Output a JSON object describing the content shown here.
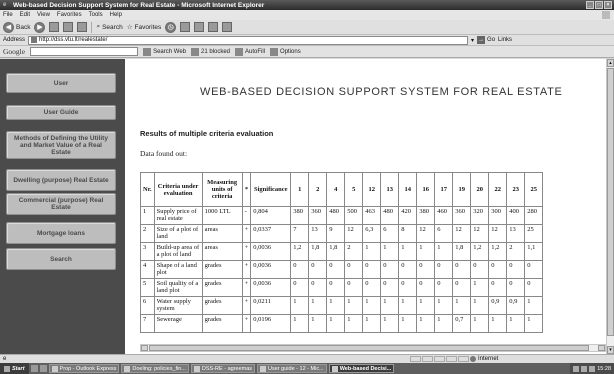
{
  "window": {
    "title": "Web-based Decision Support System for Real Estate - Microsoft Internet Explorer",
    "menu": [
      "File",
      "Edit",
      "View",
      "Favorites",
      "Tools",
      "Help"
    ]
  },
  "toolbar": {
    "back": "Back",
    "search": "Search",
    "favorites": "Favorites"
  },
  "address": {
    "label": "Address",
    "url": "http://dss.vtu.lt/realestate/",
    "go": "Go",
    "links": "Links"
  },
  "googlebar": {
    "logo": "Google",
    "search_web": "Search Web",
    "blocked": "21 blocked",
    "autofill": "AutoFill",
    "options": "Options"
  },
  "sidebar": {
    "items": [
      {
        "label": "User"
      },
      {
        "label": "User Guide"
      },
      {
        "label": "Methods of Defining the Utility and Market Value of a Real Estate"
      },
      {
        "label": "Dwelling (purpose) Real Estate"
      },
      {
        "label": "Commercial (purpose) Real Estate"
      },
      {
        "label": "Mortgage loans"
      },
      {
        "label": "Search"
      }
    ]
  },
  "main": {
    "title": "WEB-BASED DECISION SUPPORT SYSTEM FOR REAL ESTATE",
    "section_title": "Results of multiple criteria evaluation",
    "found_text": "Data found out:"
  },
  "table": {
    "headers": [
      "Nr.",
      "Criteria under evaluation",
      "Measuring units of criteria",
      "*",
      "Significance",
      "1",
      "2",
      "4",
      "5",
      "12",
      "13",
      "14",
      "16",
      "17",
      "19",
      "20",
      "22",
      "23",
      "25"
    ],
    "rows": [
      [
        "1",
        "Supply price of real estate",
        "1000 LTL",
        "-",
        "0,804",
        "380",
        "360",
        "480",
        "500",
        "463",
        "480",
        "420",
        "380",
        "460",
        "360",
        "320",
        "300",
        "400",
        "280"
      ],
      [
        "2",
        "Size of a plot of land",
        "areas",
        "+",
        "0,0337",
        "7",
        "13",
        "9",
        "12",
        "6,3",
        "6",
        "8",
        "12",
        "6",
        "12",
        "12",
        "12",
        "13",
        "25"
      ],
      [
        "3",
        "Build-up area of a plot of land",
        "areas",
        "+",
        "0,0036",
        "1,2",
        "1,8",
        "1,8",
        "2",
        "1",
        "1",
        "1",
        "1",
        "1",
        "1,8",
        "1,2",
        "1,2",
        "2",
        "1,1"
      ],
      [
        "4",
        "Shape of a land plot",
        "grades",
        "+",
        "0,0036",
        "0",
        "0",
        "0",
        "0",
        "0",
        "0",
        "0",
        "0",
        "0",
        "0",
        "0",
        "0",
        "0",
        "0"
      ],
      [
        "5",
        "Soil quality of a land plot",
        "grades",
        "+",
        "0,0036",
        "0",
        "0",
        "0",
        "0",
        "0",
        "0",
        "0",
        "0",
        "0",
        "0",
        "1",
        "0",
        "0",
        "0"
      ],
      [
        "6",
        "Water supply system",
        "grades",
        "+",
        "0,0211",
        "1",
        "1",
        "1",
        "1",
        "1",
        "1",
        "1",
        "1",
        "1",
        "1",
        "1",
        "0,9",
        "0,9",
        "1"
      ],
      [
        "7",
        "Sewerage",
        "grades",
        "+",
        "0,0196",
        "1",
        "1",
        "1",
        "1",
        "1",
        "1",
        "1",
        "1",
        "1",
        "0,7",
        "1",
        "1",
        "1",
        "1"
      ]
    ]
  },
  "statusbar": {
    "zone": "Internet"
  },
  "taskbar": {
    "start": "Start",
    "tasks": [
      "Prop - Outlook Express",
      "Doeling: policies_fin...",
      "DSS-RE - agreemas",
      "User guide - 12 - Mic...",
      "Web-based Decisi..."
    ],
    "clock": "15:28"
  }
}
